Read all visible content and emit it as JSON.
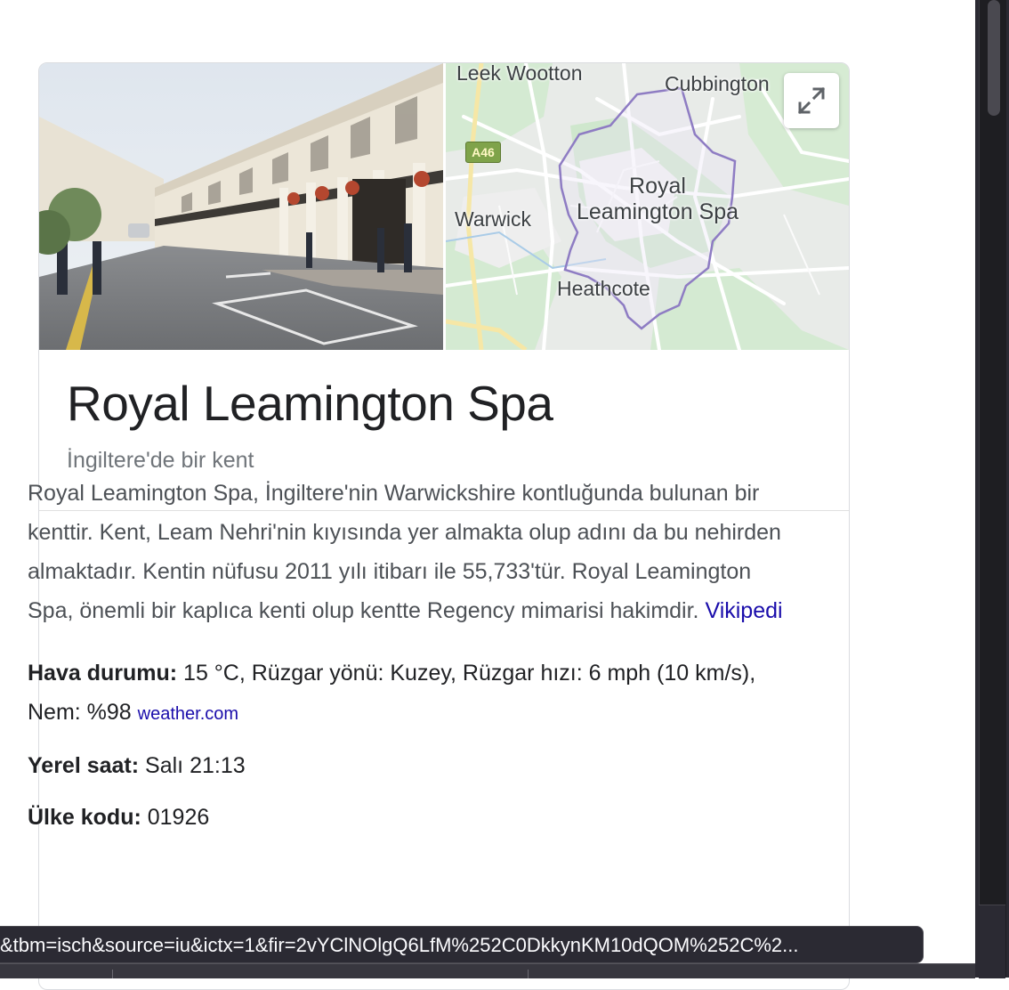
{
  "card": {
    "title": "Royal Leamington Spa",
    "subtitle": "İngiltere'de bir kent",
    "description": "Royal Leamington Spa, İngiltere'nin Warwickshire kontluğunda bulunan bir kenttir. Kent, Leam Nehri'nin kıyısında yer almakta olup adını da bu nehirden almaktadır. Kentin nüfusu 2011 yılı itibarı ile 55,733'tür. Royal Leamington Spa, önemli bir kaplıca kenti olup kentte Regency mimarisi hakimdir.",
    "description_link": "Vikipedi",
    "facts": {
      "weather_label": "Hava durumu:",
      "weather_value": "15 °C, Rüzgar yönü: Kuzey, Rüzgar hızı: 6 mph (10 km/s), Nem: %98",
      "weather_source": "weather.com",
      "local_time_label": "Yerel saat:",
      "local_time_value": "Salı 21:13",
      "country_code_label": "Ülke kodu:",
      "country_code_value": "01926"
    }
  },
  "map": {
    "labels": {
      "leek_wootton": "Leek Wootton",
      "cubbington": "Cubbington",
      "warwick": "Warwick",
      "city_line1": "Royal",
      "city_line2": "Leamington Spa",
      "heathcote": "Heathcote"
    },
    "road_shield": "A46",
    "expand_icon": "expand-icon"
  },
  "statusbar": {
    "url": "&tbm=isch&source=iu&ictx=1&fir=2vYClNOlgQ6LfM%252C0DkkynKM10dQOM%252C%2..."
  },
  "colors": {
    "link": "#1a0dab",
    "boundary": "#8e7cc3",
    "map_green": "#c8e6c9"
  }
}
